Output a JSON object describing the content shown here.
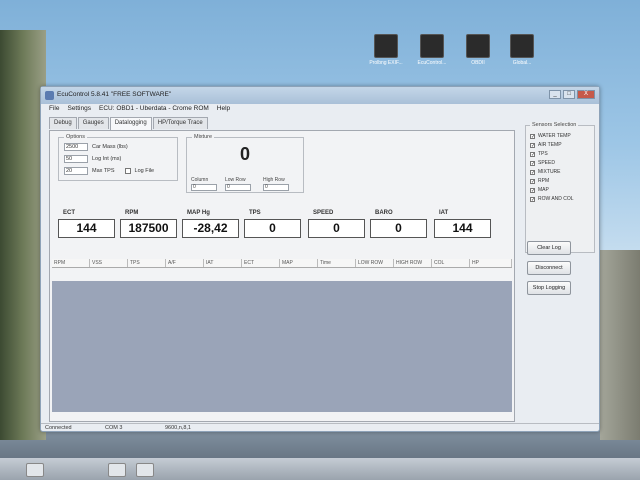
{
  "desktop": {
    "icons": [
      {
        "caption": "Prolbng\nEXIF...",
        "icon": "app-shortcut-icon"
      },
      {
        "caption": "EcuControl...",
        "icon": "app-shortcut-icon"
      },
      {
        "caption": "OBDII",
        "icon": "app-shortcut-icon"
      },
      {
        "caption": "Global...",
        "icon": "app-shortcut-icon"
      }
    ]
  },
  "window": {
    "title": "EcuControl 5.8.41 \"FREE SOFTWARE\"",
    "controls": {
      "minimize": "_",
      "maximize": "□",
      "close": "X"
    }
  },
  "menu": [
    "File",
    "Settings",
    "ECU: OBD1 - Uberdata - Crome ROM",
    "Help"
  ],
  "tabs": [
    "Debug",
    "Gauges",
    "Datalogging",
    "HP/Torque Trace"
  ],
  "active_tab": "Datalogging",
  "options": {
    "legend": "Options",
    "car_mass": {
      "value": "2500",
      "label": "Car Mass (lbs)"
    },
    "log_int": {
      "value": "50",
      "label": "Log Int (ms)"
    },
    "max_tps": {
      "value": "20",
      "label": "Max TPS"
    },
    "log_file": {
      "label": "Log File",
      "checked": false
    }
  },
  "mixture": {
    "legend": "Mixture",
    "value": "0",
    "column": {
      "label": "Column",
      "value": "0"
    },
    "low_row": {
      "label": "Low Row",
      "value": "0"
    },
    "high_row": {
      "label": "High Row",
      "value": "0"
    }
  },
  "gauges": [
    {
      "label": "ECT",
      "value": "144"
    },
    {
      "label": "RPM",
      "value": "187500"
    },
    {
      "label": "MAP  Hg",
      "value": "-28,42"
    },
    {
      "label": "TPS",
      "value": "0"
    },
    {
      "label": "SPEED",
      "value": "0"
    },
    {
      "label": "BARO",
      "value": "0"
    },
    {
      "label": "IAT",
      "value": "144"
    }
  ],
  "log_columns": [
    "RPM",
    "VSS",
    "TPS",
    "A/F",
    "IAT",
    "ECT",
    "MAP",
    "Time",
    "LOW ROW",
    "HIGH ROW",
    "COL",
    "HP"
  ],
  "sensor_selection": {
    "legend": "Sensors Selection",
    "items": [
      {
        "label": "WATER TEMP",
        "checked": true
      },
      {
        "label": "AIR TEMP",
        "checked": true
      },
      {
        "label": "TPS",
        "checked": true
      },
      {
        "label": "SPEED",
        "checked": true
      },
      {
        "label": "MIXTURE",
        "checked": true
      },
      {
        "label": "RPM",
        "checked": true
      },
      {
        "label": "MAP",
        "checked": true
      },
      {
        "label": "ROW AND COL",
        "checked": true
      }
    ],
    "check_glyph": "✓"
  },
  "buttons": {
    "clear_log": "Clear Log",
    "disconnect": "Disconnect",
    "stop_logging": "Stop Logging"
  },
  "status": {
    "connection": "Connected",
    "port": "COM 3",
    "baud": "9600,n,8,1"
  },
  "colors": {
    "log_area": "#9aa4b8",
    "title_bar": "#b6cbe0"
  }
}
